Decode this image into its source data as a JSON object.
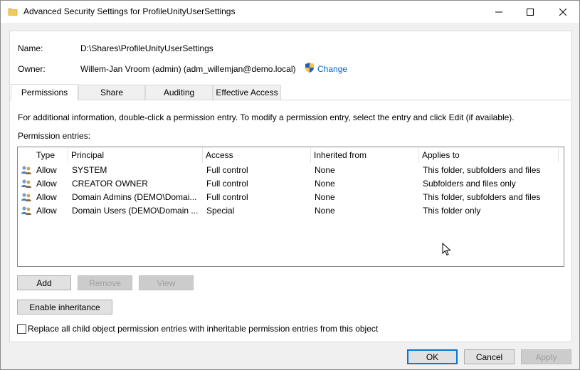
{
  "window": {
    "title": "Advanced Security Settings for ProfileUnityUserSettings"
  },
  "details": {
    "name_label": "Name:",
    "name_value": "D:\\Shares\\ProfileUnityUserSettings",
    "owner_label": "Owner:",
    "owner_value": "Willem-Jan Vroom (admin) (adm_willemjan@demo.local)",
    "change_link": "Change"
  },
  "tabs": [
    {
      "label": "Permissions",
      "active": true
    },
    {
      "label": "Share",
      "active": false
    },
    {
      "label": "Auditing",
      "active": false
    },
    {
      "label": "Effective Access",
      "active": false
    }
  ],
  "permissions": {
    "info_text": "For additional information, double-click a permission entry. To modify a permission entry, select the entry and click Edit (if available).",
    "entries_label": "Permission entries:",
    "columns": [
      "Type",
      "Principal",
      "Access",
      "Inherited from",
      "Applies to"
    ],
    "rows": [
      {
        "type": "Allow",
        "principal": "SYSTEM",
        "access": "Full control",
        "inherited": "None",
        "applies": "This folder, subfolders and files"
      },
      {
        "type": "Allow",
        "principal": "CREATOR OWNER",
        "access": "Full control",
        "inherited": "None",
        "applies": "Subfolders and files only"
      },
      {
        "type": "Allow",
        "principal": "Domain Admins (DEMO\\Domai...",
        "access": "Full control",
        "inherited": "None",
        "applies": "This folder, subfolders and files"
      },
      {
        "type": "Allow",
        "principal": "Domain Users (DEMO\\Domain ...",
        "access": "Special",
        "inherited": "None",
        "applies": "This folder only"
      }
    ],
    "buttons": {
      "add": "Add",
      "remove": "Remove",
      "view": "View",
      "enable_inheritance": "Enable inheritance"
    },
    "replace_checkbox_label": "Replace all child object permission entries with inheritable permission entries from this object",
    "replace_checked": false
  },
  "footer": {
    "ok": "OK",
    "cancel": "Cancel",
    "apply": "Apply"
  },
  "colors": {
    "link": "#0066cc",
    "focus_border": "#0078d7",
    "disabled_text": "#a0a0a0"
  },
  "icons": {
    "title": "folder-icon",
    "owner_change": "uac-shield-icon",
    "row": "users-group-icon"
  }
}
